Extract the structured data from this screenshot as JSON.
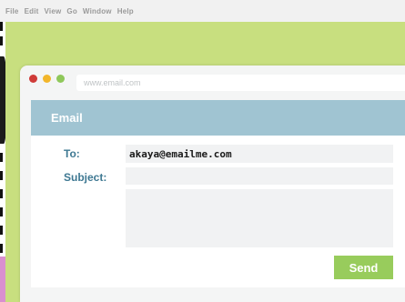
{
  "menubar": {
    "items": [
      "File",
      "Edit",
      "View",
      "Go",
      "Window",
      "Help"
    ]
  },
  "browser": {
    "address": "www.email.com"
  },
  "email": {
    "title": "Email",
    "to_label": "To:",
    "to_value": "akaya@emailme.com",
    "subject_label": "Subject:",
    "subject_value": "",
    "body_value": "",
    "send_label": "Send"
  },
  "colors": {
    "desktop": "#c8df7f",
    "header": "#a0c4d2",
    "label": "#3e7892",
    "send": "#98cc5c"
  }
}
